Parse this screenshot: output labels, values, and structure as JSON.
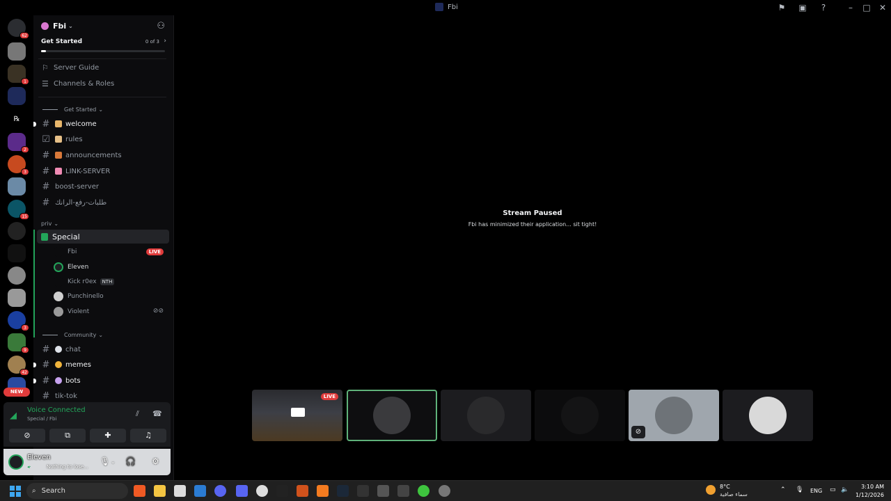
{
  "window": {
    "title": "Fbi"
  },
  "rail": {
    "badges": [
      "62",
      "1",
      "2",
      "3",
      "15",
      "3",
      "9",
      "42"
    ],
    "new_label": "NEW"
  },
  "server": {
    "name": "Fbi",
    "get_started": {
      "label": "Get Started",
      "progress_text": "0 of 3",
      "progress": 0.04
    },
    "nav": [
      {
        "label": "Server Guide",
        "icon": "signpost-icon"
      },
      {
        "label": "Channels & Roles",
        "icon": "list-icon"
      }
    ],
    "categories": {
      "get_started": "Get Started",
      "priv": "priv",
      "community": "Community"
    },
    "channels_top": [
      {
        "label": "welcome",
        "emoji_color": "#e8b66b",
        "unread": true
      },
      {
        "label": "rules",
        "emoji_color": "#e6c088",
        "unread": false
      },
      {
        "label": "announcements",
        "emoji_color": "#d9793a",
        "unread": false
      },
      {
        "label": "LINK-SERVER",
        "emoji_color": "#f08bb4",
        "unread": false
      },
      {
        "label": "boost-server",
        "emoji_color": "",
        "unread": false
      },
      {
        "label": "طلبات-رفع-الرانك",
        "emoji_color": "",
        "unread": false
      }
    ],
    "voice_channel": "Special",
    "voice_users": [
      {
        "name": "Fbi",
        "live": "LIVE"
      },
      {
        "name": "Eleven"
      },
      {
        "name": "Kick r0ex",
        "tag": "NTH"
      },
      {
        "name": "Punchinello"
      },
      {
        "name": "Violent"
      }
    ],
    "channels_bottom": [
      {
        "label": "chat",
        "emoji_color": "#dfe3ea",
        "unread": false
      },
      {
        "label": "memes",
        "emoji_color": "#f0b43c",
        "unread": true
      },
      {
        "label": "bots",
        "emoji_color": "#c7a2ef",
        "unread": true
      },
      {
        "label": "tik-tok",
        "emoji_color": "",
        "unread": false
      }
    ]
  },
  "voice_panel": {
    "status": "Voice Connected",
    "location": "Special / Fbi"
  },
  "user": {
    "name": "Eleven",
    "status": "Nothing to lose..."
  },
  "stage": {
    "title": "Stream Paused",
    "subtitle": "Fbi has minimized their application... sit tight!",
    "live_label": "LIVE"
  },
  "taskbar": {
    "search": "Search",
    "weather_temp": "8°C",
    "weather_desc": "سماء صافية",
    "weather_badge": "3",
    "lang": "ENG",
    "time": "3:10 AM",
    "date": "1/12/2026"
  },
  "colors": {
    "accent_green": "#23a55a",
    "live_red": "#e03b3b"
  }
}
